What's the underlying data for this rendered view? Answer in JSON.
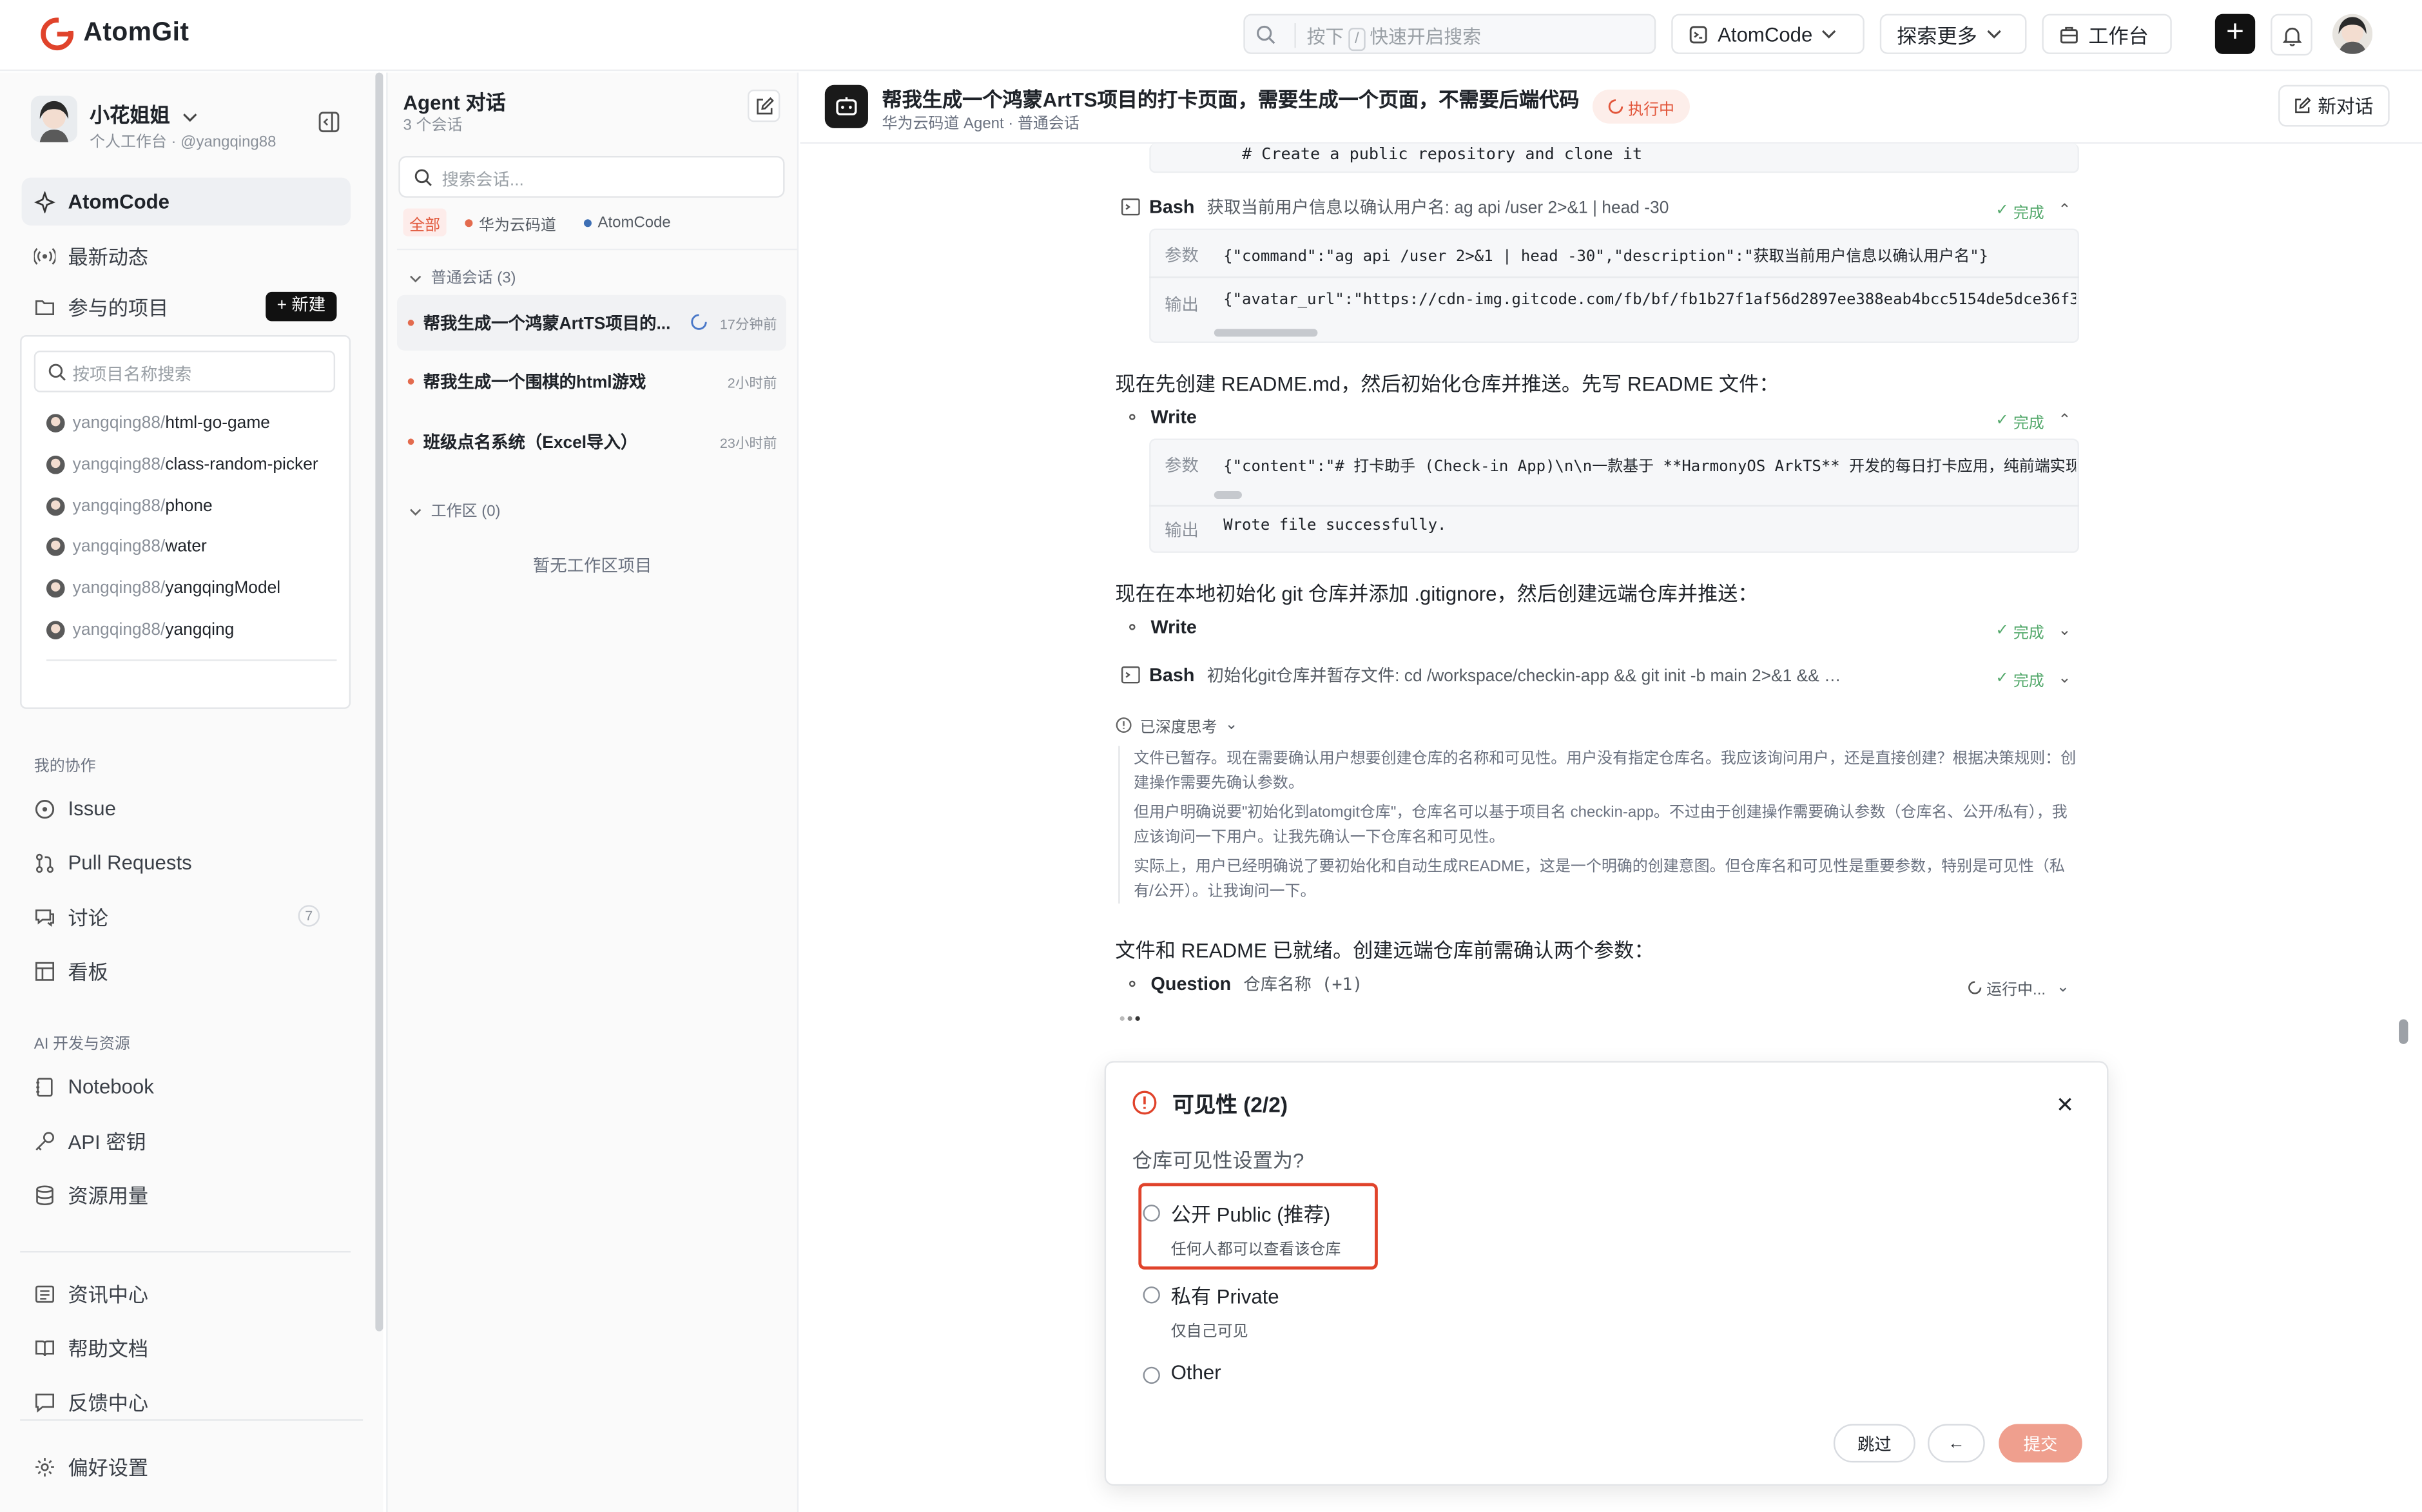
{
  "app": {
    "logo_text": "AtomGit"
  },
  "topbar": {
    "search_placeholder_pre": "按下",
    "search_key": "/",
    "search_placeholder_post": "快速开启搜索",
    "atomcode_label": "AtomCode",
    "explore_label": "探索更多",
    "workbench_label": "工作台",
    "plus_label": "+"
  },
  "sidebar": {
    "user_name": "小花姐姐",
    "user_sub": "个人工作台 · @yangqing88",
    "nav_atomcode": "AtomCode",
    "nav_latest": "最新动态",
    "nav_projects": "参与的项目",
    "new_button": "+ 新建",
    "project_search_placeholder": "按项目名称搜索",
    "projects": [
      {
        "owner": "yangqing88/",
        "name": "html-go-game"
      },
      {
        "owner": "yangqing88/",
        "name": "class-random-picker"
      },
      {
        "owner": "yangqing88/",
        "name": "phone"
      },
      {
        "owner": "yangqing88/",
        "name": "water"
      },
      {
        "owner": "yangqing88/",
        "name": "yangqingModel"
      },
      {
        "owner": "yangqing88/",
        "name": "yangqing"
      }
    ],
    "section_collab": "我的协作",
    "nav_issue": "Issue",
    "nav_pr": "Pull Requests",
    "nav_discuss": "讨论",
    "discuss_count": "7",
    "nav_board": "看板",
    "section_ai": "AI 开发与资源",
    "nav_notebook": "Notebook",
    "nav_api": "API 密钥",
    "nav_usage": "资源用量",
    "nav_news": "资讯中心",
    "nav_help": "帮助文档",
    "nav_feedback": "反馈中心",
    "nav_prefs": "偏好设置"
  },
  "conversations": {
    "title": "Agent 对话",
    "count": "3 个会话",
    "search_placeholder": "搜索会话...",
    "filters": [
      "全部",
      "华为云码道",
      "AtomCode"
    ],
    "group_normal": "普通会话",
    "group_normal_count": "(3)",
    "items": [
      {
        "title": "帮我生成一个鸿蒙ArtTS项目的...",
        "time": "17分钟前"
      },
      {
        "title": "帮我生成一个围棋的html游戏",
        "time": "2小时前"
      },
      {
        "title": "班级点名系统（Excel导入）",
        "time": "23小时前"
      }
    ],
    "group_ws": "工作区",
    "group_ws_count": "(0)",
    "ws_empty": "暂无工作区项目"
  },
  "main": {
    "title": "帮我生成一个鸿蒙ArtTS项目的打卡页面，需要生成一个页面，不需要后端代码",
    "subtitle": "华为云码道 Agent · 普通会话",
    "status": "执行中",
    "new_conversation": "新对话",
    "code_top": "# Create a public repository and clone it",
    "tool1": {
      "name": "Bash",
      "desc": "获取当前用户信息以确认用户名: ag api /user 2>&1 | head -30",
      "status": "完成",
      "param_label": "参数",
      "param": "{\"command\":\"ag api /user 2>&1 | head -30\",\"description\":\"获取当前用户信息以确认用户名\"}",
      "output_label": "输出",
      "output": "{\"avatar_url\":\"https://cdn-img.gitcode.com/fb/bf/fb1b27f1af56d2897ee388eab4bcc5154de5dce36f3"
    },
    "para1": "现在先创建 README.md，然后初始化仓库并推送。先写 README 文件：",
    "tool2": {
      "name": "Write",
      "status": "完成",
      "param_label": "参数",
      "param": "{\"content\":\"# 打卡助手 (Check-in App)\\n\\n一款基于 **HarmonyOS ArkTS** 开发的每日打卡应用，纯前端实现",
      "output_label": "输出",
      "output": "Wrote file successfully."
    },
    "para2": "现在在本地初始化 git 仓库并添加 .gitignore，然后创建远端仓库并推送：",
    "tool3": {
      "name": "Write",
      "status": "完成"
    },
    "tool4": {
      "name": "Bash",
      "desc": "初始化git仓库并暂存文件: cd /workspace/checkin-app && git init -b main 2>&1 && …",
      "status": "完成"
    },
    "thinking_label": "已深度思考",
    "thinking": [
      "文件已暂存。现在需要确认用户想要创建仓库的名称和可见性。用户没有指定仓库名。我应该询问用户，还是直接创建？根据决策规则：创建操作需要先确认参数。",
      "但用户明确说要\"初始化到atomgit仓库\"，仓库名可以基于项目名 checkin-app。不过由于创建操作需要确认参数（仓库名、公开/私有），我应该询问一下用户。让我先确认一下仓库名和可见性。",
      "实际上，用户已经明确说了要初始化和自动生成README，这是一个明确的创建意图。但仓库名和可见性是重要参数，特别是可见性（私有/公开）。让我询问一下。"
    ],
    "para3": "文件和 README 已就绪。创建远端仓库前需确认两个参数：",
    "question": {
      "name": "Question",
      "desc": "仓库名称 (+1)",
      "status": "运行中..."
    }
  },
  "dialog": {
    "title": "可见性 (2/2)",
    "question": "仓库可见性设置为?",
    "options": [
      {
        "label": "公开 Public (推荐)",
        "desc": "任何人都可以查看该仓库"
      },
      {
        "label": "私有 Private",
        "desc": "仅自己可见"
      },
      {
        "label": "Other",
        "desc": ""
      }
    ],
    "skip": "跳过",
    "back": "←",
    "submit": "提交"
  },
  "colors": {
    "accent": "#e2563b",
    "done": "#52a86a",
    "highlight": "#e0432b"
  }
}
